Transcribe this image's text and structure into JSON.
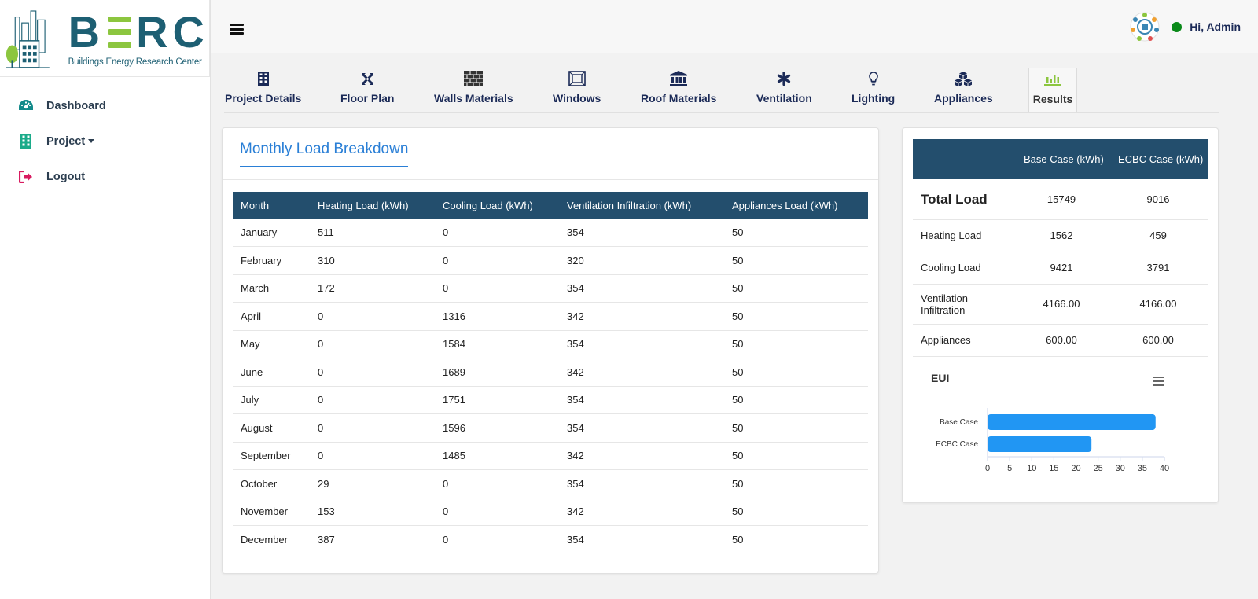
{
  "brand": {
    "name_left": "B",
    "name_right": "RC",
    "subtitle": "Buildings Energy Research Center",
    "colors": {
      "primary": "#1d5f73",
      "accent": "#8cc63f"
    }
  },
  "sidebar": {
    "items": [
      {
        "label": "Dashboard",
        "icon": "tachometer-icon"
      },
      {
        "label": "Project",
        "icon": "building-icon"
      },
      {
        "label": "Logout",
        "icon": "sign-out-icon"
      }
    ]
  },
  "header": {
    "greeting": "Hi, Admin",
    "status_color": "#0a8a1a"
  },
  "tabs": [
    {
      "label": "Project Details",
      "icon": "building-icon"
    },
    {
      "label": "Floor Plan",
      "icon": "expand-arrows-icon"
    },
    {
      "label": "Walls Materials",
      "icon": "brick-wall-icon"
    },
    {
      "label": "Windows",
      "icon": "window-icon"
    },
    {
      "label": "Roof Materials",
      "icon": "landmark-icon"
    },
    {
      "label": "Ventilation",
      "icon": "asterisk-icon"
    },
    {
      "label": "Lighting",
      "icon": "lightbulb-icon"
    },
    {
      "label": "Appliances",
      "icon": "cubes-icon"
    },
    {
      "label": "Results",
      "icon": "bar-chart-icon",
      "active": true
    }
  ],
  "monthly": {
    "title": "Monthly Load Breakdown",
    "columns": [
      "Month",
      "Heating Load (kWh)",
      "Cooling Load (kWh)",
      "Ventilation Infiltration (kWh)",
      "Appliances Load (kWh)"
    ],
    "rows": [
      [
        "January",
        "511",
        "0",
        "354",
        "50"
      ],
      [
        "February",
        "310",
        "0",
        "320",
        "50"
      ],
      [
        "March",
        "172",
        "0",
        "354",
        "50"
      ],
      [
        "April",
        "0",
        "1316",
        "342",
        "50"
      ],
      [
        "May",
        "0",
        "1584",
        "354",
        "50"
      ],
      [
        "June",
        "0",
        "1689",
        "342",
        "50"
      ],
      [
        "July",
        "0",
        "1751",
        "354",
        "50"
      ],
      [
        "August",
        "0",
        "1596",
        "354",
        "50"
      ],
      [
        "September",
        "0",
        "1485",
        "342",
        "50"
      ],
      [
        "October",
        "29",
        "0",
        "354",
        "50"
      ],
      [
        "November",
        "153",
        "0",
        "342",
        "50"
      ],
      [
        "December",
        "387",
        "0",
        "354",
        "50"
      ]
    ]
  },
  "summary": {
    "columns": [
      "",
      "Base Case (kWh)",
      "ECBC Case (kWh)"
    ],
    "rows": [
      [
        "Total Load",
        "15749",
        "9016"
      ],
      [
        "Heating Load",
        "1562",
        "459"
      ],
      [
        "Cooling Load",
        "9421",
        "3791"
      ],
      [
        "Ventilation Infiltration",
        "4166.00",
        "4166.00"
      ],
      [
        "Appliances",
        "600.00",
        "600.00"
      ]
    ]
  },
  "chart_data": {
    "type": "bar",
    "orientation": "horizontal",
    "title": "EUI",
    "categories": [
      "Base Case",
      "ECBC Case"
    ],
    "values": [
      38,
      23.5
    ],
    "xlim": [
      0,
      40
    ],
    "xticks": [
      0,
      5,
      10,
      15,
      20,
      25,
      30,
      35,
      40
    ],
    "color": "#2196f3",
    "grid": false,
    "legend": "none"
  }
}
